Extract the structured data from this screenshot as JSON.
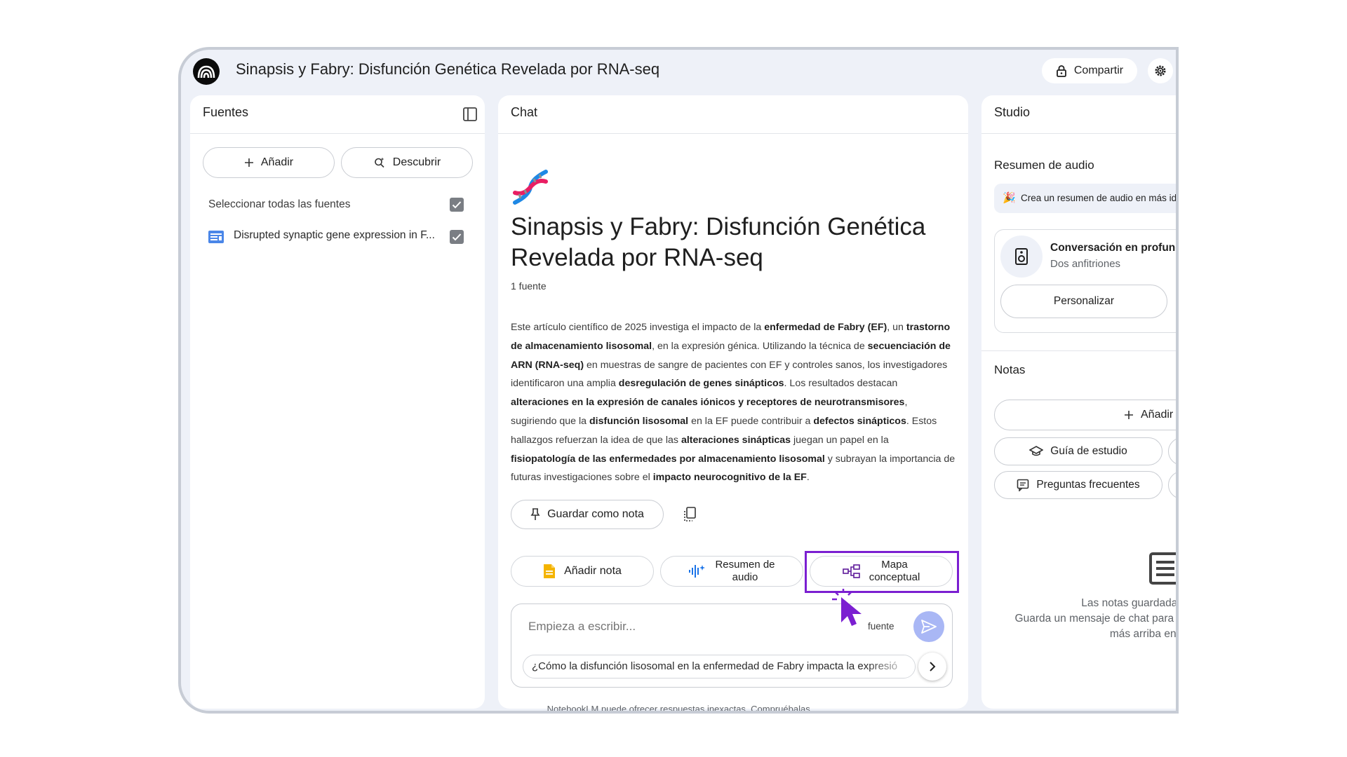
{
  "app": {
    "title": "Sinapsis y Fabry: Disfunción Genética Revelada por RNA-seq"
  },
  "header": {
    "share_label": "Compartir"
  },
  "sources": {
    "title": "Fuentes",
    "add_label": "Añadir",
    "discover_label": "Descubrir",
    "select_all_label": "Seleccionar todas las fuentes",
    "items": [
      {
        "title": "Disrupted synaptic gene expression in F..."
      }
    ]
  },
  "chat": {
    "title": "Chat",
    "heading_line1": "Sinapsis y Fabry: Disfunción Genética",
    "heading_line2": "Revelada por RNA-seq",
    "source_count": "1 fuente",
    "summary": [
      {
        "t": "Este artículo científico de 2025 investiga el impacto de la "
      },
      {
        "t": "enfermedad de Fabry (EF)",
        "b": true
      },
      {
        "t": ", un "
      },
      {
        "t": "trastorno de almacenamiento lisosomal",
        "b": true
      },
      {
        "t": ", en la expresión génica. Utilizando la técnica de "
      },
      {
        "t": "secuenciación de ARN (RNA-seq)",
        "b": true
      },
      {
        "t": " en muestras de sangre de pacientes con EF y controles sanos, los investigadores identificaron una amplia "
      },
      {
        "t": "desregulación de genes sinápticos",
        "b": true
      },
      {
        "t": ". Los resultados destacan "
      },
      {
        "t": "alteraciones en la expresión de canales iónicos y receptores de neurotransmisores",
        "b": true
      },
      {
        "t": ", sugiriendo que la "
      },
      {
        "t": "disfunción lisosomal",
        "b": true
      },
      {
        "t": " en la EF puede contribuir a "
      },
      {
        "t": "defectos sinápticos",
        "b": true
      },
      {
        "t": ". Estos hallazgos refuerzan la idea de que las "
      },
      {
        "t": "alteraciones sinápticas",
        "b": true
      },
      {
        "t": " juegan un papel en la "
      },
      {
        "t": "fisiopatología de las enfermedades por almacenamiento lisosomal",
        "b": true
      },
      {
        "t": " y subrayan la importancia de futuras investigaciones sobre el "
      },
      {
        "t": "impacto neurocognitivo de la EF",
        "b": true
      },
      {
        "t": "."
      }
    ],
    "save_note_label": "Guardar como nota",
    "add_note_label": "Añadir nota",
    "audio_summary_line1": "Resumen de",
    "audio_summary_line2": "audio",
    "mindmap_line1": "Mapa",
    "mindmap_line2": "conceptual",
    "input_placeholder": "Empieza a escribir...",
    "input_source_label": "fuente",
    "suggested_question": "¿Cómo la disfunción lisosomal en la enfermedad de Fabry impacta la expresió"
  },
  "studio": {
    "title": "Studio",
    "audio_title": "Resumen de audio",
    "banner": "Crea un resumen de audio en más idi",
    "conversation_title": "Conversación en profundid",
    "conversation_subtitle": "Dos anfitriones",
    "customize_label": "Personalizar",
    "notes_title": "Notas",
    "add_note_label": "Añadir n",
    "study_guide_label": "Guía de estudio",
    "faq_label": "Preguntas frecuentes",
    "empty_line1": "Las notas guardadas a",
    "empty_line2": "Guarda un mensaje de chat para cre",
    "empty_line3": "más arriba en Añ"
  },
  "footer": {
    "disclaimer": "NotebookLM puede ofrecer respuestas inexactas. Compruébalas."
  },
  "colors": {
    "accent_purple": "#7b1fd1",
    "send_blue": "#a9b7f5",
    "doc_blue": "#4a86e8",
    "note_yellow": "#f4b400"
  }
}
